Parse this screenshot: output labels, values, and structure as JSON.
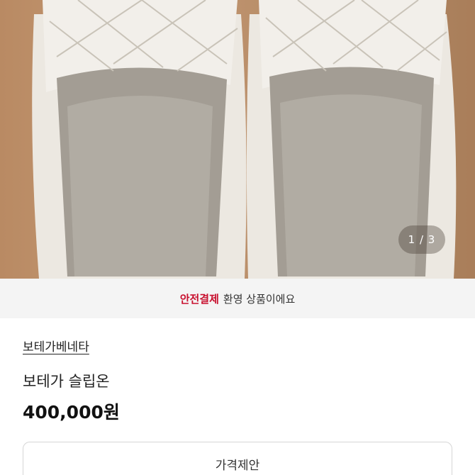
{
  "gallery": {
    "counter": "1 / 3"
  },
  "notice": {
    "highlight": "안전결제",
    "text": "환영 상품이에요",
    "highlight_color": "#c8102e"
  },
  "product": {
    "brand": "보테가베네타",
    "title": "보테가 슬립온",
    "price": "400,000원"
  },
  "actions": {
    "offer_label": "가격제안"
  }
}
